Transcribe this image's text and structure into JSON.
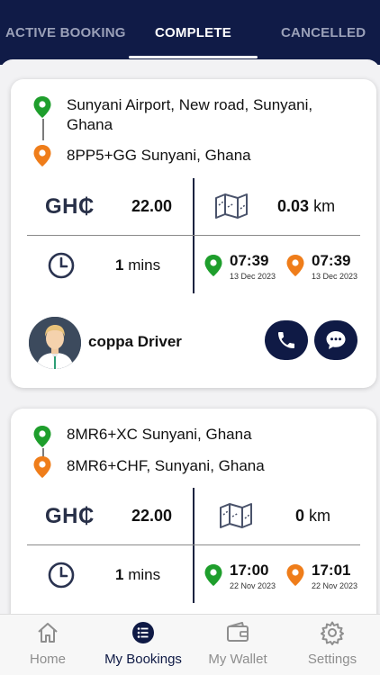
{
  "tabs": [
    {
      "label": "ACTIVE BOOKING",
      "active": false
    },
    {
      "label": "COMPLETE",
      "active": true
    },
    {
      "label": "CANCELLED",
      "active": false
    }
  ],
  "bookings": [
    {
      "pickup": "Sunyani Airport, New road, Sunyani, Ghana",
      "dropoff": "8PP5+GG Sunyani, Ghana",
      "currency": "GH₵",
      "fare": "22.00",
      "distance_value": "0.03",
      "distance_unit": "km",
      "duration_value": "1",
      "duration_unit": "mins",
      "start_time": "07:39",
      "start_date": "13 Dec 2023",
      "end_time": "07:39",
      "end_date": "13 Dec 2023",
      "driver_name": "coppa Driver"
    },
    {
      "pickup": "8MR6+XC Sunyani, Ghana",
      "dropoff": "8MR6+CHF, Sunyani, Ghana",
      "currency": "GH₵",
      "fare": "22.00",
      "distance_value": "0",
      "distance_unit": "km",
      "duration_value": "1",
      "duration_unit": "mins",
      "start_time": "17:00",
      "start_date": "22 Nov 2023",
      "end_time": "17:01",
      "end_date": "22 Nov 2023"
    }
  ],
  "nav": [
    {
      "label": "Home",
      "icon": "home-icon",
      "active": false
    },
    {
      "label": "My Bookings",
      "icon": "list-icon",
      "active": true
    },
    {
      "label": "My Wallet",
      "icon": "wallet-icon",
      "active": false
    },
    {
      "label": "Settings",
      "icon": "gear-icon",
      "active": false
    }
  ],
  "colors": {
    "navy": "#101b47",
    "pickup_green": "#1e9e2c",
    "dropoff_orange": "#ef7d1a"
  }
}
